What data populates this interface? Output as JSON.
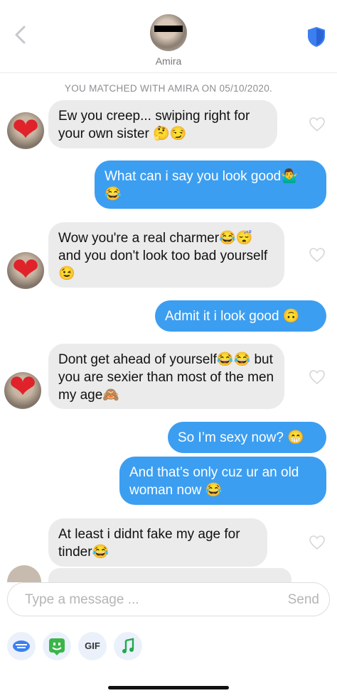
{
  "header": {
    "name": "Amira"
  },
  "match_notice": "YOU MATCHED WITH AMIRA ON 05/10/2020.",
  "messages": [
    {
      "side": "in",
      "text": "Ew you creep... swiping right for your own sister 🤔😏"
    },
    {
      "side": "out",
      "text": "What can i say you look good🤷‍♂️ 😂"
    },
    {
      "side": "in",
      "text": "Wow you're a real charmer😂😴 and you don't look too bad yourself😉"
    },
    {
      "side": "out",
      "text": "Admit it i look good 🙃"
    },
    {
      "side": "in",
      "text": "Dont get ahead of yourself😂😂 but you are sexier than most of the men my age🙈"
    },
    {
      "side": "out",
      "text": "So I’m sexy now? 😁"
    },
    {
      "side": "out",
      "text": "And that’s only cuz ur an old woman now 😂"
    },
    {
      "side": "in",
      "text": "At least i didnt fake my age for tinder😂"
    }
  ],
  "composer": {
    "placeholder": "Type a message ...",
    "send_label": "Send"
  },
  "toolbar": {
    "gif_label": "GIF"
  },
  "colors": {
    "accent": "#3c9ef0",
    "incoming_bubble": "#ebebec",
    "heart": "#e0222b",
    "gif_icon_bg": "#eaf1fb"
  }
}
